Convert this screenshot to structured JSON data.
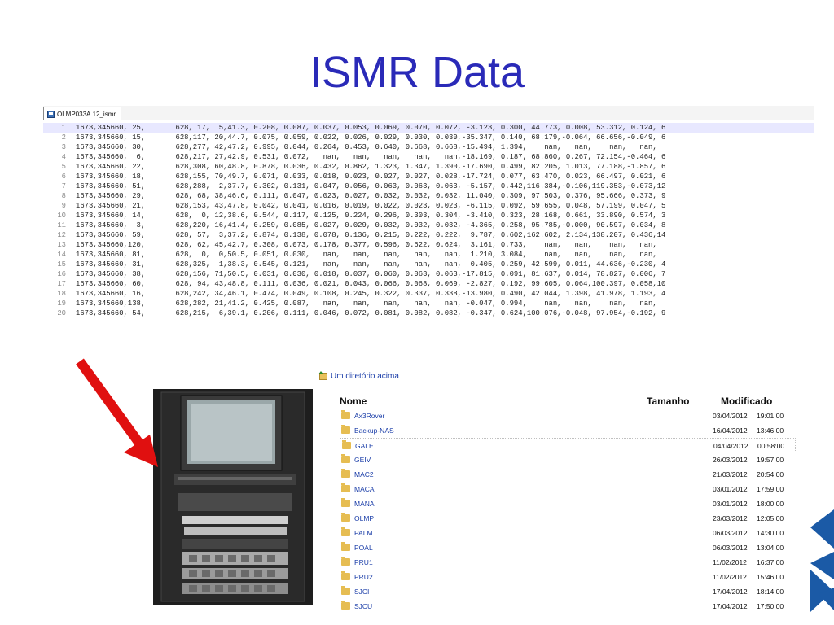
{
  "title": "ISMR Data",
  "editor": {
    "tab_label": "OLMP033A.12_ismr",
    "lines": [
      {
        "n": "1",
        "t": "1673,345660, 25,       628, 17,  5,41.3, 0.208, 0.087, 0.037, 0.053, 0.069, 0.070, 0.072, -3.123, 0.300, 44.773, 0.008, 53.312, 0.124, 6"
      },
      {
        "n": "2",
        "t": "1673,345660, 15,       628,117, 20,44.7, 0.075, 0.059, 0.022, 0.026, 0.029, 0.030, 0.030,-35.347, 0.140, 68.179,-0.064, 66.656,-0.049, 6"
      },
      {
        "n": "3",
        "t": "1673,345660, 30,       628,277, 42,47.2, 0.995, 0.044, 0.264, 0.453, 0.640, 0.668, 0.668,-15.494, 1.394,    nan,   nan,    nan,   nan,"
      },
      {
        "n": "4",
        "t": "1673,345660,  6,       628,217, 27,42.9, 0.531, 0.072,   nan,   nan,   nan,   nan,   nan,-18.169, 0.187, 68.860, 0.267, 72.154,-0.464, 6"
      },
      {
        "n": "5",
        "t": "1673,345660, 22,       628,308, 60,48.8, 0.878, 0.036, 0.432, 0.862, 1.323, 1.347, 1.390,-17.690, 0.499, 82.205, 1.013, 77.188,-1.857, 6"
      },
      {
        "n": "6",
        "t": "1673,345660, 18,       628,155, 70,49.7, 0.071, 0.033, 0.018, 0.023, 0.027, 0.027, 0.028,-17.724, 0.077, 63.470, 0.023, 66.497, 0.021, 6"
      },
      {
        "n": "7",
        "t": "1673,345660, 51,       628,288,  2,37.7, 0.302, 0.131, 0.047, 0.056, 0.063, 0.063, 0.063, -5.157, 0.442,116.384,-0.106,119.353,-0.073,12"
      },
      {
        "n": "8",
        "t": "1673,345660, 29,       628, 68, 38,46.6, 0.111, 0.047, 0.023, 0.027, 0.032, 0.032, 0.032, 11.040, 0.309, 97.503, 0.376, 95.666, 0.373, 9"
      },
      {
        "n": "9",
        "t": "1673,345660, 21,       628,153, 43,47.8, 0.042, 0.041, 0.016, 0.019, 0.022, 0.023, 0.023, -6.115, 0.092, 59.655, 0.048, 57.199, 0.047, 5"
      },
      {
        "n": "10",
        "t": "1673,345660, 14,       628,  0, 12,38.6, 0.544, 0.117, 0.125, 0.224, 0.296, 0.303, 0.304, -3.410, 0.323, 28.168, 0.661, 33.890, 0.574, 3"
      },
      {
        "n": "11",
        "t": "1673,345660,  3,       628,220, 16,41.4, 0.259, 0.085, 0.027, 0.029, 0.032, 0.032, 0.032, -4.365, 0.258, 95.785,-0.000, 90.597, 0.034, 8"
      },
      {
        "n": "12",
        "t": "1673,345660, 59,       628, 57,  3,37.2, 0.874, 0.138, 0.078, 0.136, 0.215, 0.222, 0.222,  9.787, 0.602,162.602, 2.134,138.207, 0.436,14"
      },
      {
        "n": "13",
        "t": "1673,345660,120,       628, 62, 45,42.7, 0.308, 0.073, 0.178, 0.377, 0.596, 0.622, 0.624,  3.161, 0.733,    nan,   nan,    nan,   nan,"
      },
      {
        "n": "14",
        "t": "1673,345660, 81,       628,  0,  0,50.5, 0.051, 0.030,   nan,   nan,   nan,   nan,   nan,  1.210, 3.084,    nan,   nan,    nan,   nan,"
      },
      {
        "n": "15",
        "t": "1673,345660, 31,       628,325,  1,38.3, 0.545, 0.121,   nan,   nan,   nan,   nan,   nan,  0.405, 0.259, 42.599, 0.011, 44.636,-0.230, 4"
      },
      {
        "n": "16",
        "t": "1673,345660, 38,       628,156, 71,50.5, 0.031, 0.030, 0.018, 0.037, 0.060, 0.063, 0.063,-17.815, 0.091, 81.637, 0.014, 78.827, 0.006, 7"
      },
      {
        "n": "17",
        "t": "1673,345660, 60,       628, 94, 43,48.8, 0.111, 0.036, 0.021, 0.043, 0.066, 0.068, 0.069, -2.827, 0.192, 99.605, 0.064,100.397, 0.058,10"
      },
      {
        "n": "18",
        "t": "1673,345660, 16,       628,242, 34,46.1, 0.474, 0.049, 0.108, 0.245, 0.322, 0.337, 0.338,-13.980, 0.490, 42.044, 1.398, 41.978, 1.193, 4"
      },
      {
        "n": "19",
        "t": "1673,345660,138,       628,282, 21,41.2, 0.425, 0.087,   nan,   nan,   nan,   nan,   nan, -0.047, 0.994,    nan,   nan,    nan,   nan,"
      },
      {
        "n": "20",
        "t": "1673,345660, 54,       628,215,  6,39.1, 0.206, 0.111, 0.046, 0.072, 0.081, 0.082, 0.082, -0.347, 0.624,100.076,-0.048, 97.954,-0.192, 9"
      }
    ]
  },
  "filebrowser": {
    "up_label": "Um diretório acima",
    "col_name": "Nome",
    "col_size": "Tamanho",
    "col_modified": "Modificado",
    "rows": [
      {
        "name": "Ax3Rover",
        "date": "03/04/2012",
        "time": "19:01:00"
      },
      {
        "name": "Backup-NAS",
        "date": "16/04/2012",
        "time": "13:46:00"
      },
      {
        "name": "GALE",
        "date": "04/04/2012",
        "time": "00:58:00"
      },
      {
        "name": "GEIV",
        "date": "26/03/2012",
        "time": "19:57:00"
      },
      {
        "name": "MAC2",
        "date": "21/03/2012",
        "time": "20:54:00"
      },
      {
        "name": "MACA",
        "date": "03/01/2012",
        "time": "17:59:00"
      },
      {
        "name": "MANA",
        "date": "03/01/2012",
        "time": "18:00:00"
      },
      {
        "name": "OLMP",
        "date": "23/03/2012",
        "time": "12:05:00"
      },
      {
        "name": "PALM",
        "date": "06/03/2012",
        "time": "14:30:00"
      },
      {
        "name": "POAL",
        "date": "06/03/2012",
        "time": "13:04:00"
      },
      {
        "name": "PRU1",
        "date": "11/02/2012",
        "time": "16:37:00"
      },
      {
        "name": "PRU2",
        "date": "11/02/2012",
        "time": "15:46:00"
      },
      {
        "name": "SJCI",
        "date": "17/04/2012",
        "time": "18:14:00"
      },
      {
        "name": "SJCU",
        "date": "17/04/2012",
        "time": "17:50:00"
      }
    ]
  },
  "colors": {
    "title": "#2a2ab8",
    "link": "#1a3da8",
    "arrow": "#e01010",
    "logo": "#1b5aa6"
  }
}
